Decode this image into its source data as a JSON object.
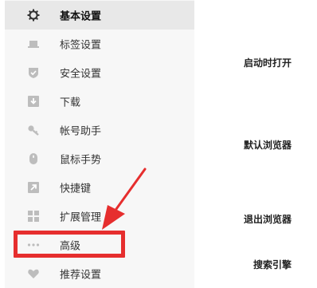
{
  "sidebar": {
    "items": [
      {
        "label": "基本设置",
        "icon": "gear-icon",
        "active": true
      },
      {
        "label": "标签设置",
        "icon": "laptop-icon"
      },
      {
        "label": "安全设置",
        "icon": "shield-check-icon"
      },
      {
        "label": "下载",
        "icon": "download-icon"
      },
      {
        "label": "帐号助手",
        "icon": "key-icon"
      },
      {
        "label": "鼠标手势",
        "icon": "mouse-icon"
      },
      {
        "label": "快捷键",
        "icon": "shortcut-arrow-icon"
      },
      {
        "label": "扩展管理",
        "icon": "extensions-grid-icon"
      },
      {
        "label": "高级",
        "icon": "more-dots-icon"
      },
      {
        "label": "推荐设置",
        "icon": "heart-icon"
      }
    ]
  },
  "main": {
    "sections": [
      {
        "title": "启动时打开"
      },
      {
        "title": "默认浏览器"
      },
      {
        "title": "退出浏览器"
      },
      {
        "title": "搜索引擎"
      }
    ]
  },
  "annotation": {
    "highlight_color": "#e62e2e",
    "highlighted_item": "高级"
  }
}
